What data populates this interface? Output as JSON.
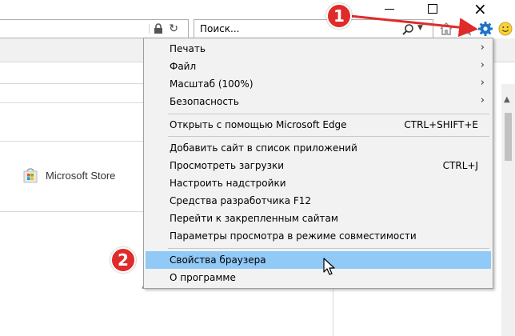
{
  "search": {
    "placeholder": "Поиск..."
  },
  "store": {
    "label": "Microsoft Store"
  },
  "menu": {
    "items": [
      {
        "label": "Печать",
        "shortcut": "",
        "submenu": true
      },
      {
        "label": "Файл",
        "shortcut": "",
        "submenu": true
      },
      {
        "label": "Масштаб (100%)",
        "shortcut": "",
        "submenu": true
      },
      {
        "label": "Безопасность",
        "shortcut": "",
        "submenu": true
      },
      {
        "label": "Открыть с помощью Microsoft Edge",
        "shortcut": "CTRL+SHIFT+E",
        "submenu": false
      },
      {
        "label": "Добавить сайт в список приложений",
        "shortcut": "",
        "submenu": false
      },
      {
        "label": "Просмотреть загрузки",
        "shortcut": "CTRL+J",
        "submenu": false
      },
      {
        "label": "Настроить надстройки",
        "shortcut": "",
        "submenu": false
      },
      {
        "label": "Средства разработчика F12",
        "shortcut": "",
        "submenu": false
      },
      {
        "label": "Перейти к закрепленным сайтам",
        "shortcut": "",
        "submenu": false
      },
      {
        "label": "Параметры просмотра в режиме совместимости",
        "shortcut": "",
        "submenu": false
      },
      {
        "label": "Свойства браузера",
        "shortcut": "",
        "submenu": false,
        "highlighted": true
      },
      {
        "label": "О программе",
        "shortcut": "",
        "submenu": false
      }
    ]
  },
  "annotations": {
    "badge1": "1",
    "badge2": "2"
  },
  "colors": {
    "badge": "#e02b2b",
    "highlight": "#91c9f7",
    "gear": "#1e73c8"
  },
  "icons": {
    "home": "home-icon",
    "favorites": "star-icon",
    "tools": "gear-icon",
    "feedback": "smile-icon",
    "lock": "lock-icon",
    "refresh": "refresh-icon",
    "search": "search-icon"
  }
}
